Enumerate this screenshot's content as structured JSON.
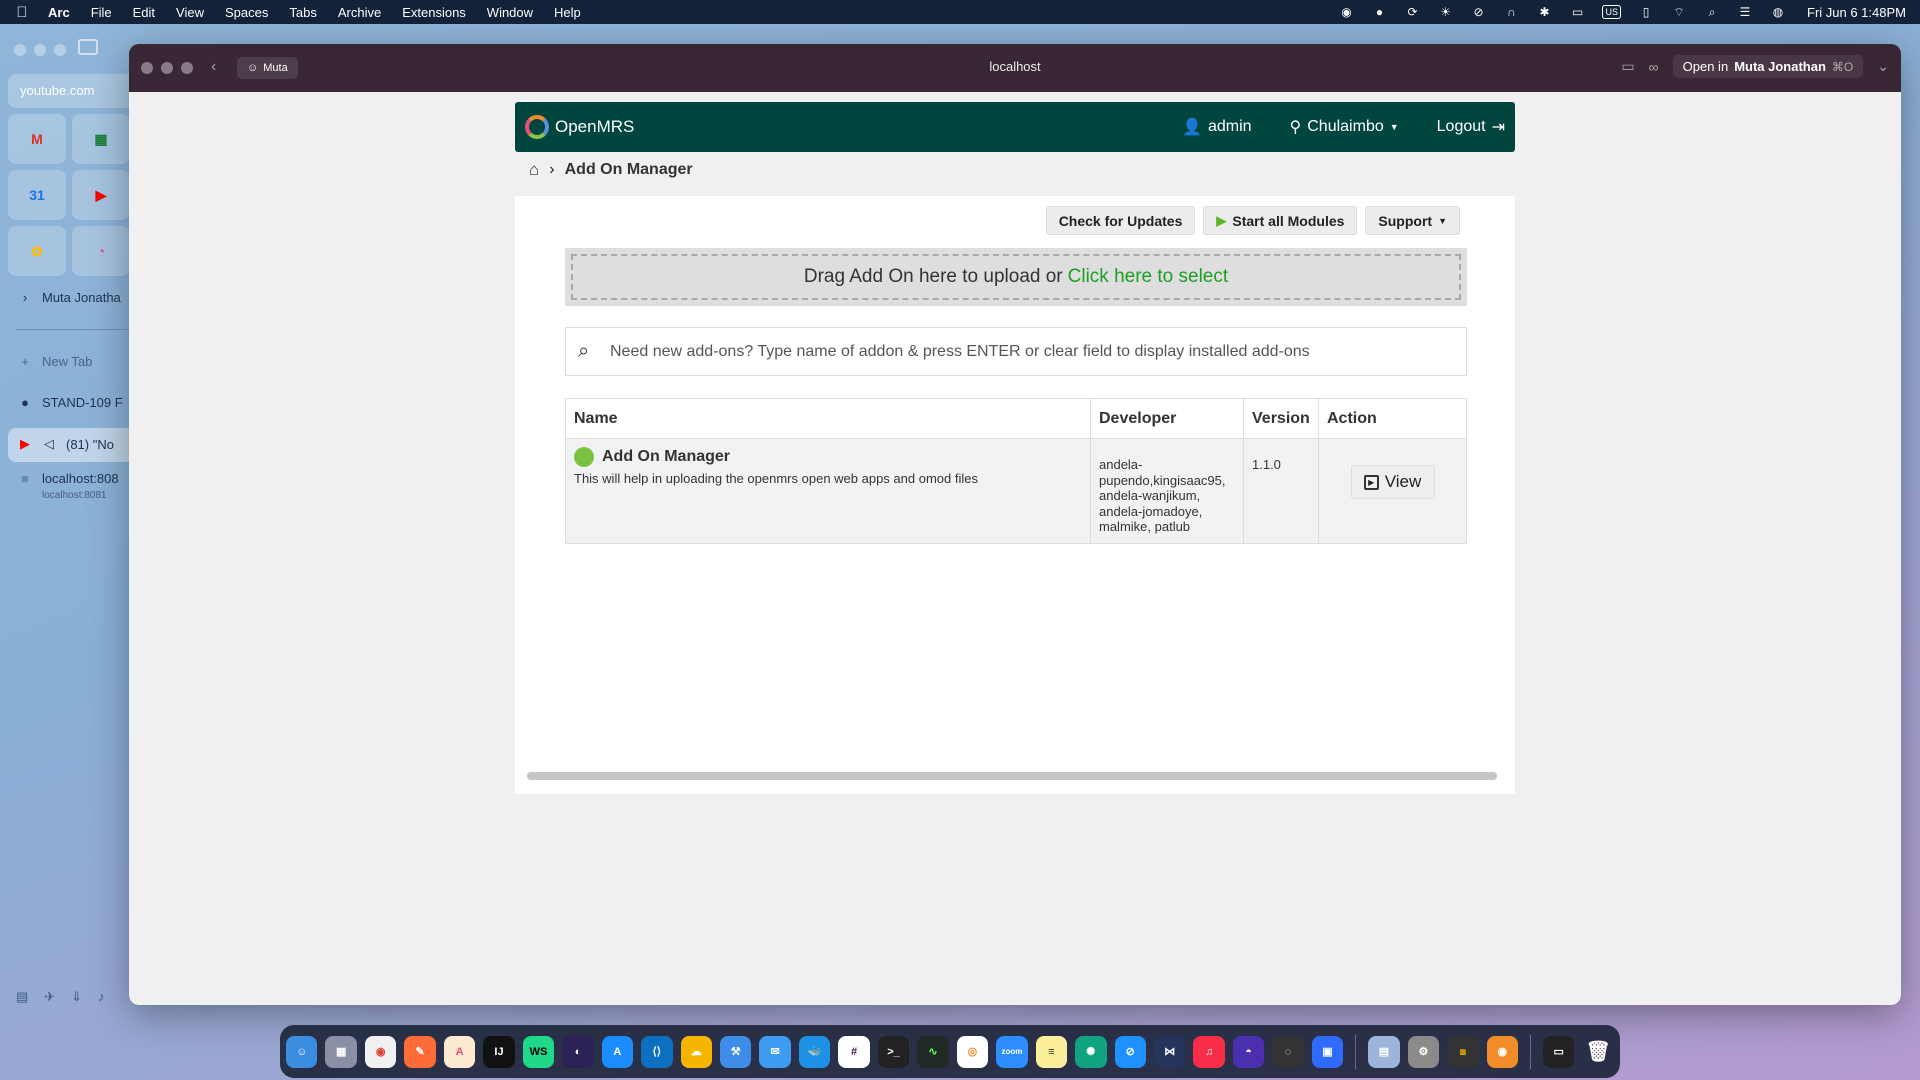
{
  "menubar": {
    "app_name": "Arc",
    "items": [
      "File",
      "Edit",
      "View",
      "Spaces",
      "Tabs",
      "Archive",
      "Extensions",
      "Window",
      "Help"
    ],
    "input_source": "US",
    "clock": "Fri Jun 6  1:48PM"
  },
  "arc_sidebar": {
    "url_pill": "youtube.com",
    "space_name": "Muta Jonatha",
    "new_tab": "New Tab",
    "tabs": [
      {
        "label": "STAND-109 F",
        "icon": "github-icon"
      },
      {
        "label": "(81) \"No",
        "icon": "youtube-icon"
      },
      {
        "label": "localhost:808",
        "sub": "localhost:8081",
        "icon": "page-icon"
      }
    ]
  },
  "window": {
    "profile": "Muta",
    "url": "localhost",
    "open_in_prefix": "Open in",
    "open_in_name": "Muta Jonathan",
    "shortcut": "⌘O"
  },
  "openmrs": {
    "logo_text": "OpenMRS",
    "user": "admin",
    "location": "Chulaimbo",
    "logout": "Logout",
    "breadcrumb_title": "Add On Manager",
    "buttons": {
      "check_updates": "Check for Updates",
      "start_modules": "Start all Modules",
      "support": "Support"
    },
    "dropzone": {
      "text": "Drag Add On here to upload or",
      "link": "Click here to select"
    },
    "search_placeholder": "Need new add-ons? Type name of addon & press ENTER or clear field to display installed add-ons",
    "table": {
      "headers": [
        "Name",
        "Developer",
        "Version",
        "Action"
      ],
      "rows": [
        {
          "name": "Add On Manager",
          "description": "This will help in uploading the openmrs open web apps and omod files",
          "developer_lines": [
            "andela-",
            "pupendo,kingisaac95,",
            "andela-wanjikum,",
            "andela-jomadoye,",
            "malmike, patlub"
          ],
          "version": "1.1.0",
          "action": "View",
          "status_color": "#7cc242"
        }
      ]
    }
  },
  "dock": {
    "apps": [
      "Finder",
      "Launchpad",
      "Chrome",
      "Postman",
      "Arc",
      "IntelliJ",
      "WebStorm",
      "Eclipse",
      "App Store",
      "VS Code",
      "Stack",
      "Xcode",
      "Mail",
      "Docker",
      "Slack",
      "Terminal",
      "Activity",
      "OpenMRS",
      "Zoom",
      "Notes",
      "ChatGPT",
      "Safari",
      "Workbench",
      "Music",
      "Proton",
      "Shortcuts",
      "Quick",
      "Preview",
      "Settings",
      "Stats",
      "Arc2",
      "Terminal2",
      "Trash"
    ]
  },
  "colors": {
    "header_green": "#00463f",
    "link_green": "#1c9f22",
    "status_green": "#7cc242"
  }
}
